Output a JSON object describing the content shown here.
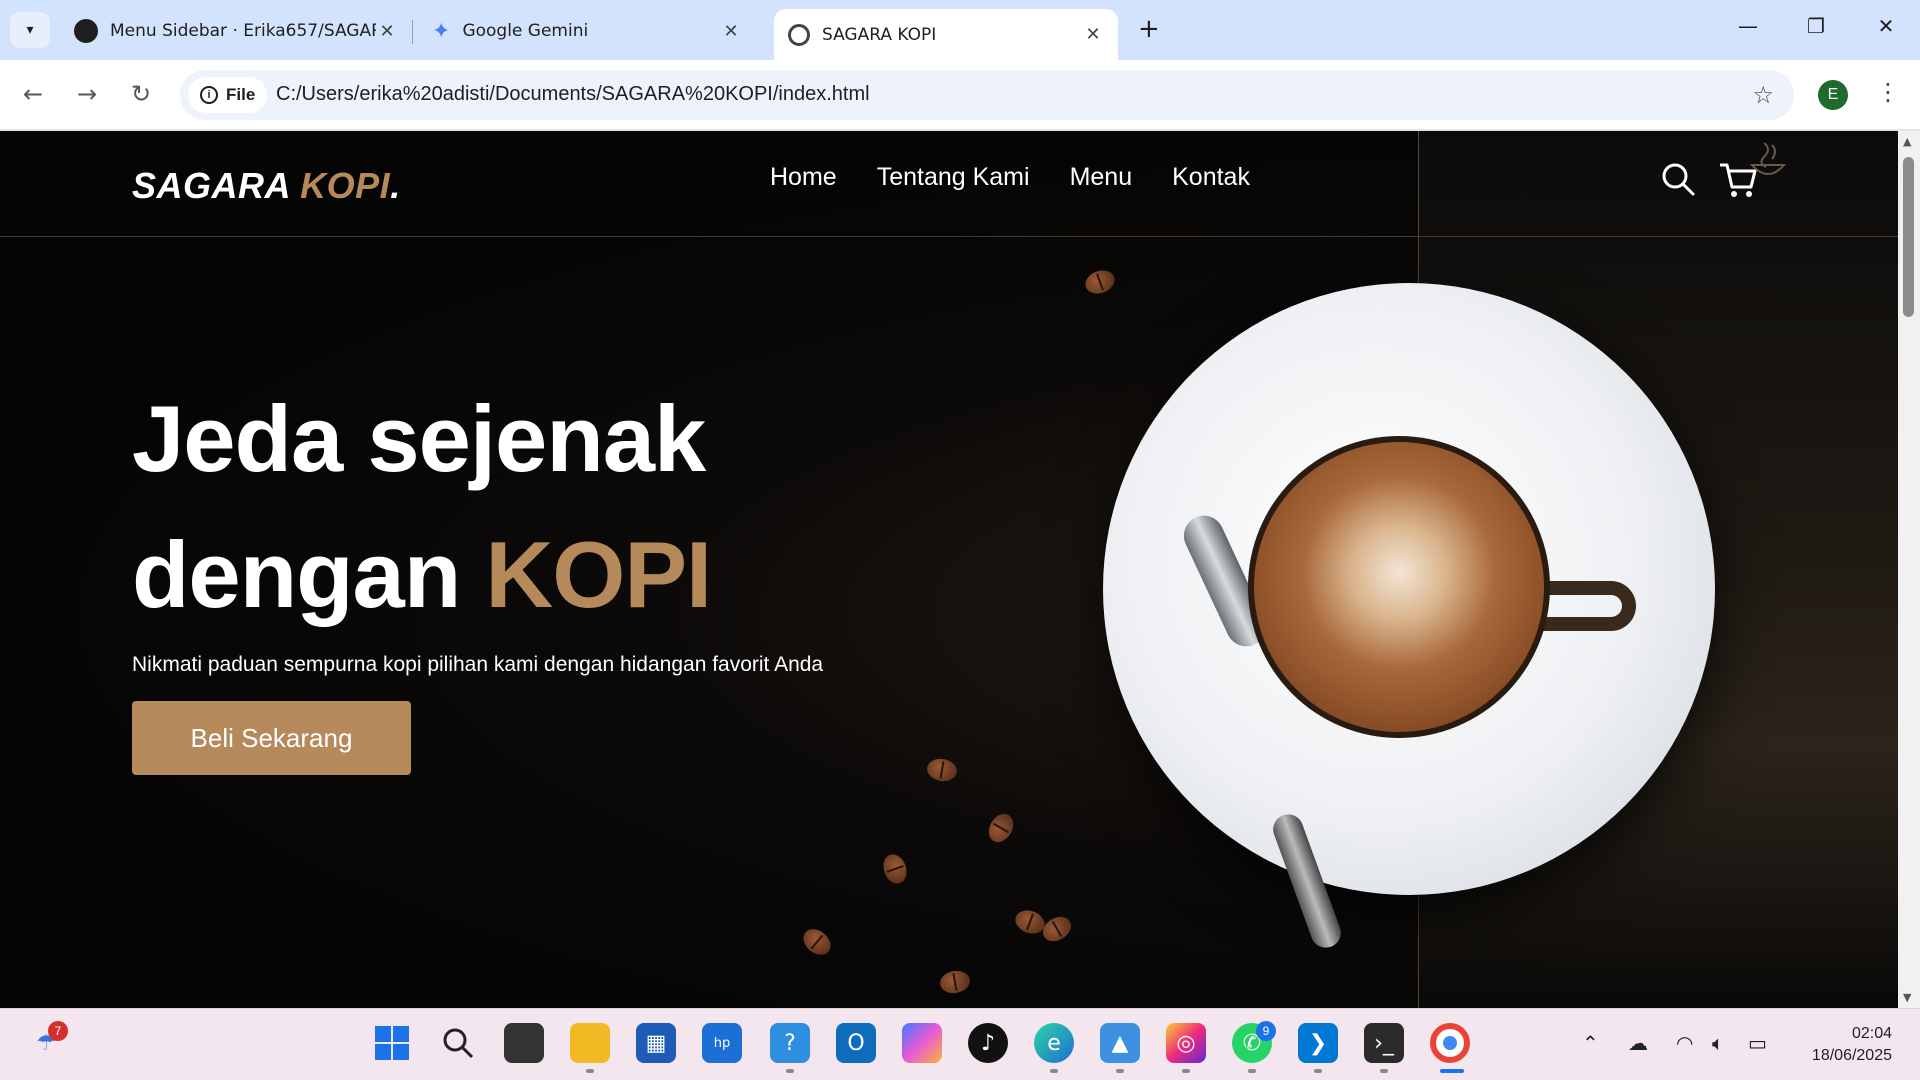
{
  "browser": {
    "tabs": [
      {
        "title": "Menu Sidebar · Erika657/SAGAR",
        "icon": "github-icon"
      },
      {
        "title": "Google Gemini",
        "icon": "gemini-icon"
      },
      {
        "title": "SAGARA KOPI",
        "icon": "globe-icon"
      }
    ],
    "address": {
      "chip_label": "File",
      "url": "C:/Users/erika%20adisti/Documents/SAGARA%20KOPI/index.html"
    },
    "profile_initial": "E"
  },
  "site": {
    "logo_main": "SAGARA ",
    "logo_accent": "KOPI",
    "logo_dot": ".",
    "nav": [
      "Home",
      "Tentang Kami",
      "Menu",
      "Kontak"
    ],
    "headline_line1": "Jeda sejenak",
    "headline_line2_prefix": "dengan ",
    "headline_line2_accent": "KOPI",
    "subtext": "Nikmati paduan sempurna kopi pilihan kami dengan hidangan favorit Anda",
    "cta": "Beli Sekarang",
    "colors": {
      "accent": "#b6895b",
      "background": "#050505",
      "text": "#ffffff"
    }
  },
  "taskbar": {
    "weather_badge": "7",
    "whatsapp_badge": "9",
    "time": "02:04",
    "date": "18/06/2025"
  }
}
